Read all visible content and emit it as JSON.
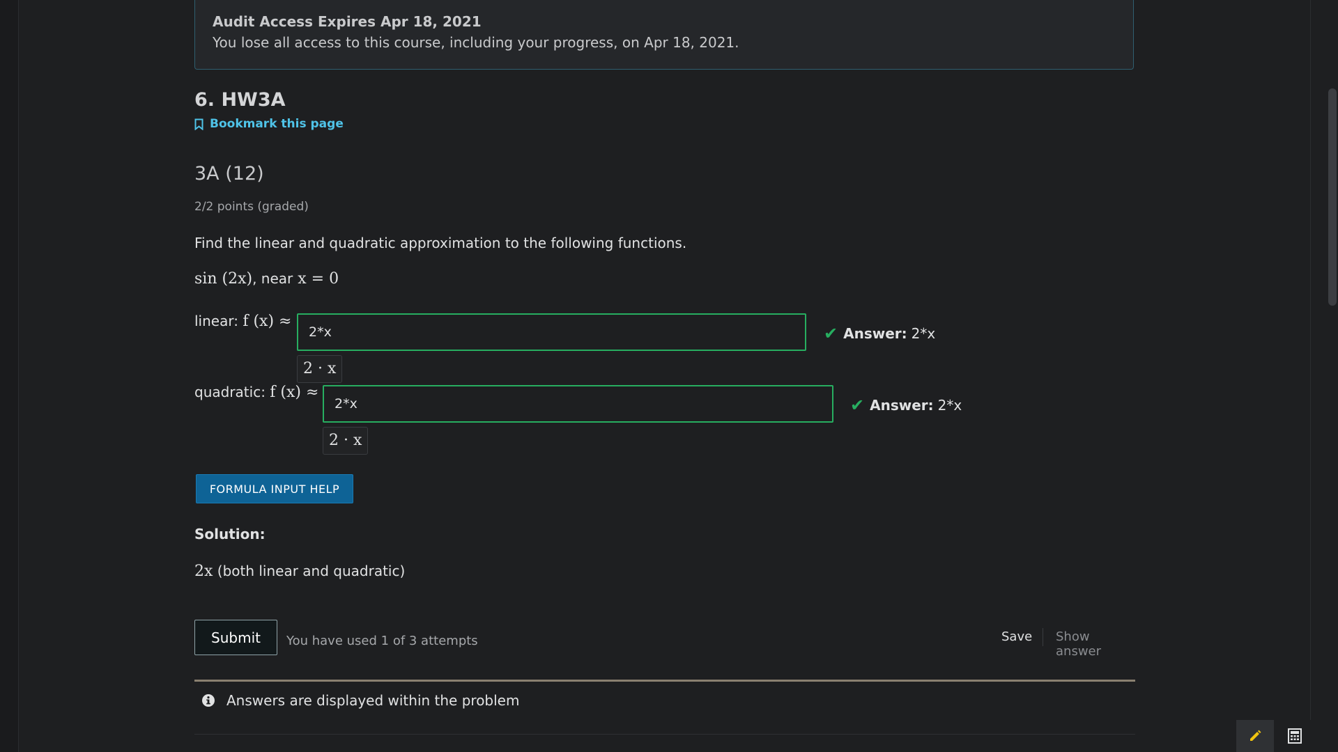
{
  "banner": {
    "title": "Audit Access Expires Apr 18, 2021",
    "text": "You lose all access to this course, including your progress, on Apr 18, 2021."
  },
  "unit": {
    "title": "6. HW3A",
    "bookmark_label": "Bookmark this page"
  },
  "problem": {
    "title": "3A (12)",
    "points": "2/2 points (graded)",
    "prompt": "Find the linear and quadratic approximation to the following functions.",
    "function": "sin (2x)",
    "near_label": ", near",
    "near_expr": "x = 0",
    "linear": {
      "label": "linear:",
      "math": "f (x) ≈",
      "value": "2*x",
      "preview": "2 · x",
      "answer_label": "Answer:",
      "answer_value": "2*x"
    },
    "quadratic": {
      "label": "quadratic:",
      "math": "f (x) ≈",
      "value": "2*x",
      "preview": "2 · x",
      "answer_label": "Answer:",
      "answer_value": "2*x"
    },
    "formula_help_label": "FORMULA INPUT HELP",
    "solution_label": "Solution:",
    "solution_math": "2x",
    "solution_text": "(both linear and quadratic)"
  },
  "actions": {
    "submit_label": "Submit",
    "attempts_text": "You have used 1 of 3 attempts",
    "save_label": "Save",
    "show_answer_label": "Show answer"
  },
  "notice": {
    "text": "Answers are displayed within the problem"
  },
  "colors": {
    "correct": "#27ae60",
    "link": "#4fc3e8",
    "primary_button": "#0e6396"
  }
}
